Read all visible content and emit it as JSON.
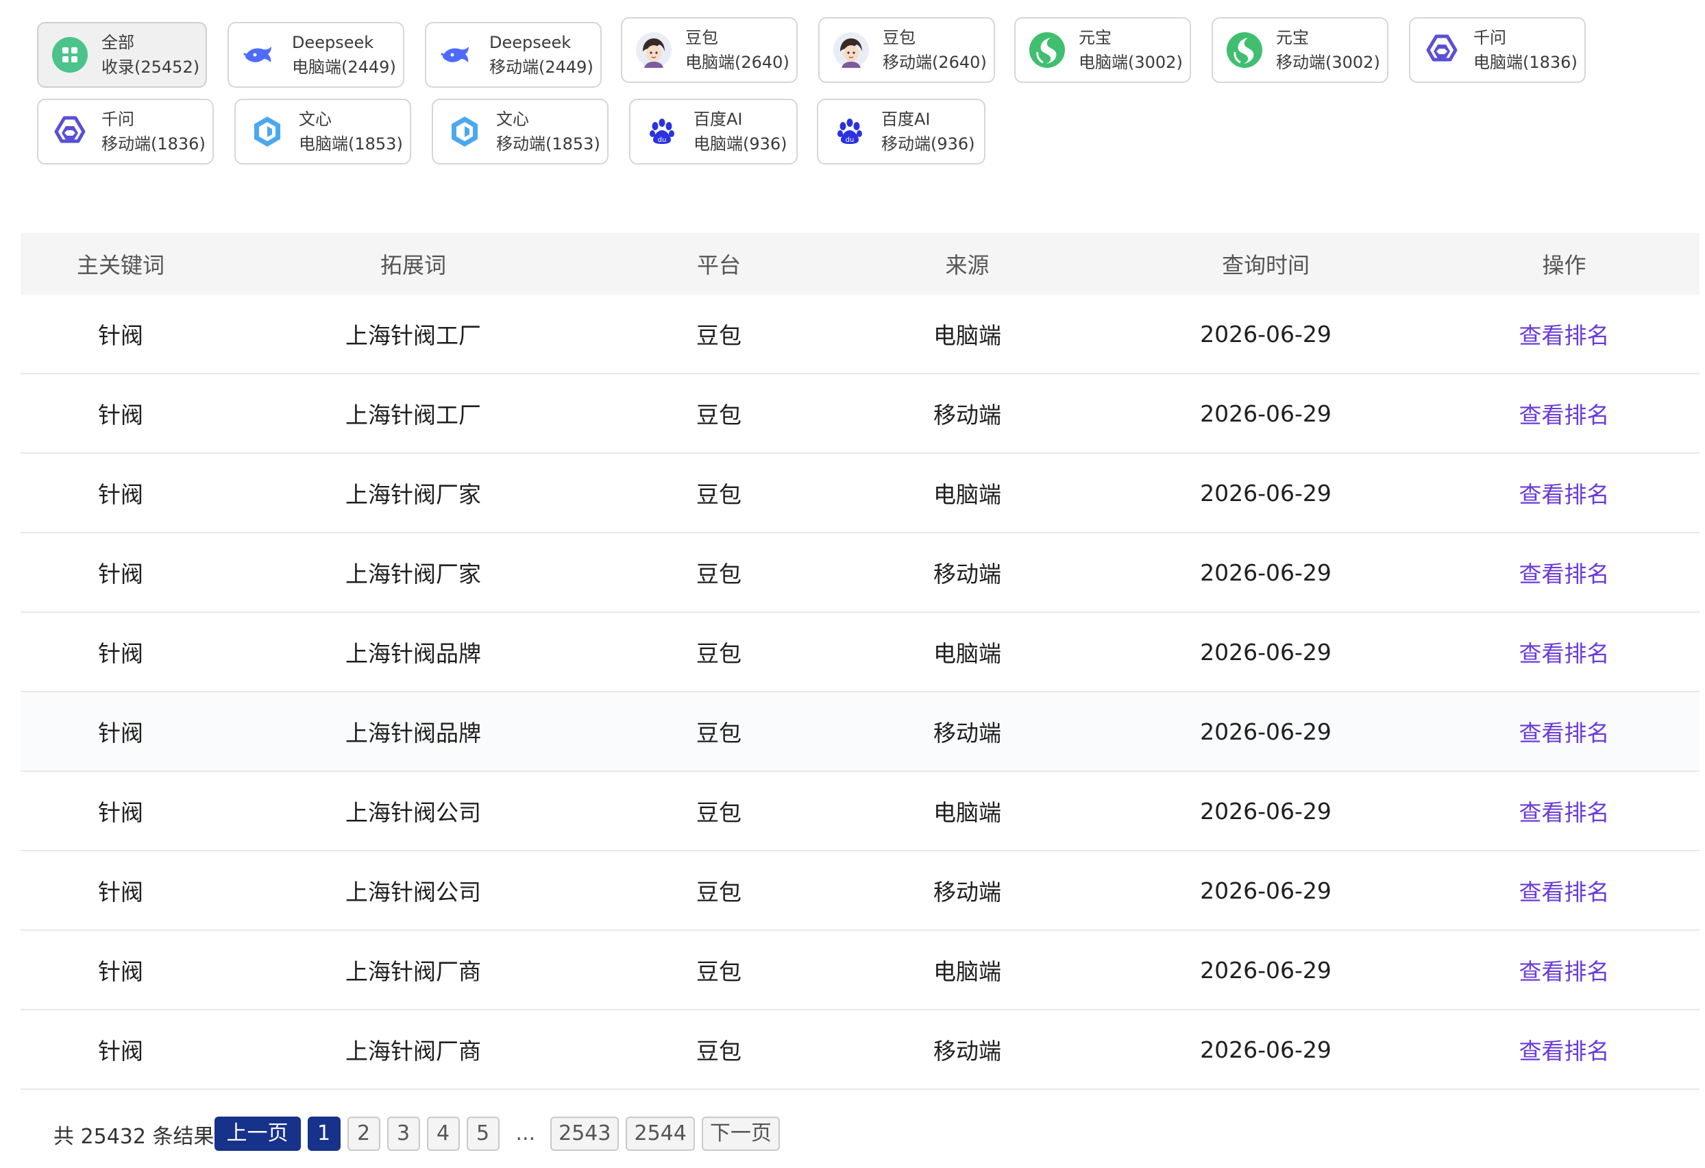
{
  "filters": [
    {
      "name": "全部",
      "sub": "收录(25452)",
      "icon": "grid-icon",
      "active": true
    },
    {
      "name": "Deepseek",
      "sub": "电脑端(2449)",
      "icon": "deepseek-whale-icon"
    },
    {
      "name": "Deepseek",
      "sub": "移动端(2449)",
      "icon": "deepseek-whale-icon"
    },
    {
      "name": "豆包",
      "sub": "电脑端(2640)",
      "icon": "doubao-avatar-icon"
    },
    {
      "name": "豆包",
      "sub": "移动端(2640)",
      "icon": "doubao-avatar-icon"
    },
    {
      "name": "元宝",
      "sub": "电脑端(3002)",
      "icon": "yuanbao-icon"
    },
    {
      "name": "元宝",
      "sub": "移动端(3002)",
      "icon": "yuanbao-icon"
    },
    {
      "name": "千问",
      "sub": "电脑端(1836)",
      "icon": "qianwen-icon"
    },
    {
      "name": "千问",
      "sub": "移动端(1836)",
      "icon": "qianwen-icon"
    },
    {
      "name": "文心",
      "sub": "电脑端(1853)",
      "icon": "wenxin-icon"
    },
    {
      "name": "文心",
      "sub": "移动端(1853)",
      "icon": "wenxin-icon"
    },
    {
      "name": "百度AI",
      "sub": "电脑端(936)",
      "icon": "baidu-paw-icon"
    },
    {
      "name": "百度AI",
      "sub": "移动端(936)",
      "icon": "baidu-paw-icon"
    }
  ],
  "table": {
    "headers": [
      "主关键词",
      "拓展词",
      "平台",
      "来源",
      "查询时间",
      "操作"
    ],
    "rows": [
      {
        "keyword": "针阀",
        "expanded": "上海针阀工厂",
        "platform": "豆包",
        "source": "电脑端",
        "date": "2026-06-29",
        "action": "查看排名"
      },
      {
        "keyword": "针阀",
        "expanded": "上海针阀工厂",
        "platform": "豆包",
        "source": "移动端",
        "date": "2026-06-29",
        "action": "查看排名"
      },
      {
        "keyword": "针阀",
        "expanded": "上海针阀厂家",
        "platform": "豆包",
        "source": "电脑端",
        "date": "2026-06-29",
        "action": "查看排名"
      },
      {
        "keyword": "针阀",
        "expanded": "上海针阀厂家",
        "platform": "豆包",
        "source": "移动端",
        "date": "2026-06-29",
        "action": "查看排名"
      },
      {
        "keyword": "针阀",
        "expanded": "上海针阀品牌",
        "platform": "豆包",
        "source": "电脑端",
        "date": "2026-06-29",
        "action": "查看排名"
      },
      {
        "keyword": "针阀",
        "expanded": "上海针阀品牌",
        "platform": "豆包",
        "source": "移动端",
        "date": "2026-06-29",
        "action": "查看排名"
      },
      {
        "keyword": "针阀",
        "expanded": "上海针阀公司",
        "platform": "豆包",
        "source": "电脑端",
        "date": "2026-06-29",
        "action": "查看排名"
      },
      {
        "keyword": "针阀",
        "expanded": "上海针阀公司",
        "platform": "豆包",
        "source": "移动端",
        "date": "2026-06-29",
        "action": "查看排名"
      },
      {
        "keyword": "针阀",
        "expanded": "上海针阀厂商",
        "platform": "豆包",
        "source": "电脑端",
        "date": "2026-06-29",
        "action": "查看排名"
      },
      {
        "keyword": "针阀",
        "expanded": "上海针阀厂商",
        "platform": "豆包",
        "source": "移动端",
        "date": "2026-06-29",
        "action": "查看排名"
      }
    ]
  },
  "pagination": {
    "total": "共 25432 条结果",
    "prev": "上一页",
    "pages": [
      "1",
      "2",
      "3",
      "4",
      "5"
    ],
    "ellipsis": "...",
    "last_pages": [
      "2543",
      "2544"
    ],
    "next": "下一页",
    "current": "1"
  },
  "colors": {
    "link": "#6a3bd8",
    "pager_active": "#16328a"
  }
}
